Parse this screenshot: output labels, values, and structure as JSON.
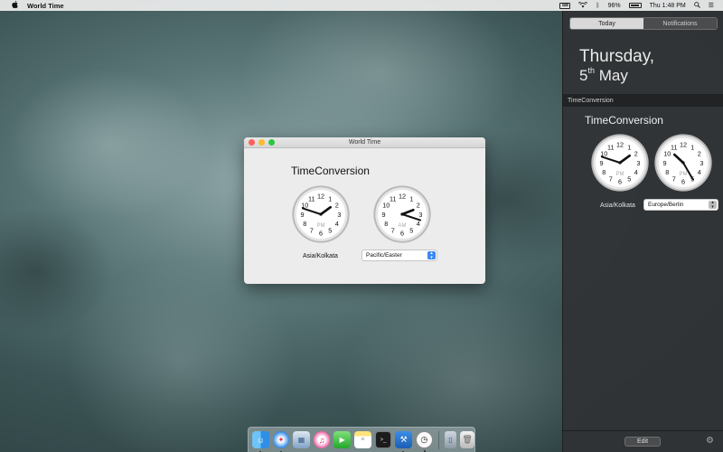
{
  "menubar": {
    "app_name": "World Time",
    "battery_percent": "96%",
    "clock": "Thu 1:48 PM",
    "icons": [
      "apple-icon",
      "keyboard-icon",
      "wifi-icon",
      "bluetooth-icon",
      "battery-icon",
      "search-icon",
      "menu-list-icon"
    ]
  },
  "window": {
    "title": "World Time",
    "heading": "TimeConversion",
    "clock1": {
      "period": "PM",
      "hour": 1,
      "minute": 48
    },
    "clock2": {
      "period": "AM",
      "hour": 2,
      "minute": 18
    },
    "label_left": "Asia/Kolkata",
    "select_value": "Pacific/Easter"
  },
  "notification_center": {
    "tab_today": "Today",
    "tab_notifications": "Notifications",
    "day": "Thursday,",
    "date_num": "5",
    "date_suffix": "th",
    "date_month": "May",
    "section": "TimeConversion",
    "widget_title": "TimeConversion",
    "clock1": {
      "period": "PM",
      "hour": 1,
      "minute": 48
    },
    "clock2": {
      "period": "PM",
      "hour": 10,
      "minute": 25
    },
    "label_left": "Asia/Kolkata",
    "select_value": "Europe/Berlin",
    "edit_label": "Edit"
  },
  "dock": {
    "apps": [
      "finder-icon",
      "safari-icon",
      "preview-icon",
      "itunes-icon",
      "facetime-icon",
      "notes-icon",
      "terminal-icon",
      "xcode-icon",
      "clock-icon",
      "simulator-icon",
      "trash-icon"
    ]
  },
  "colors": {
    "accent": "#3b87f5",
    "close": "#fc5f57",
    "minimize": "#fdbc2e",
    "maximize": "#28c840"
  }
}
